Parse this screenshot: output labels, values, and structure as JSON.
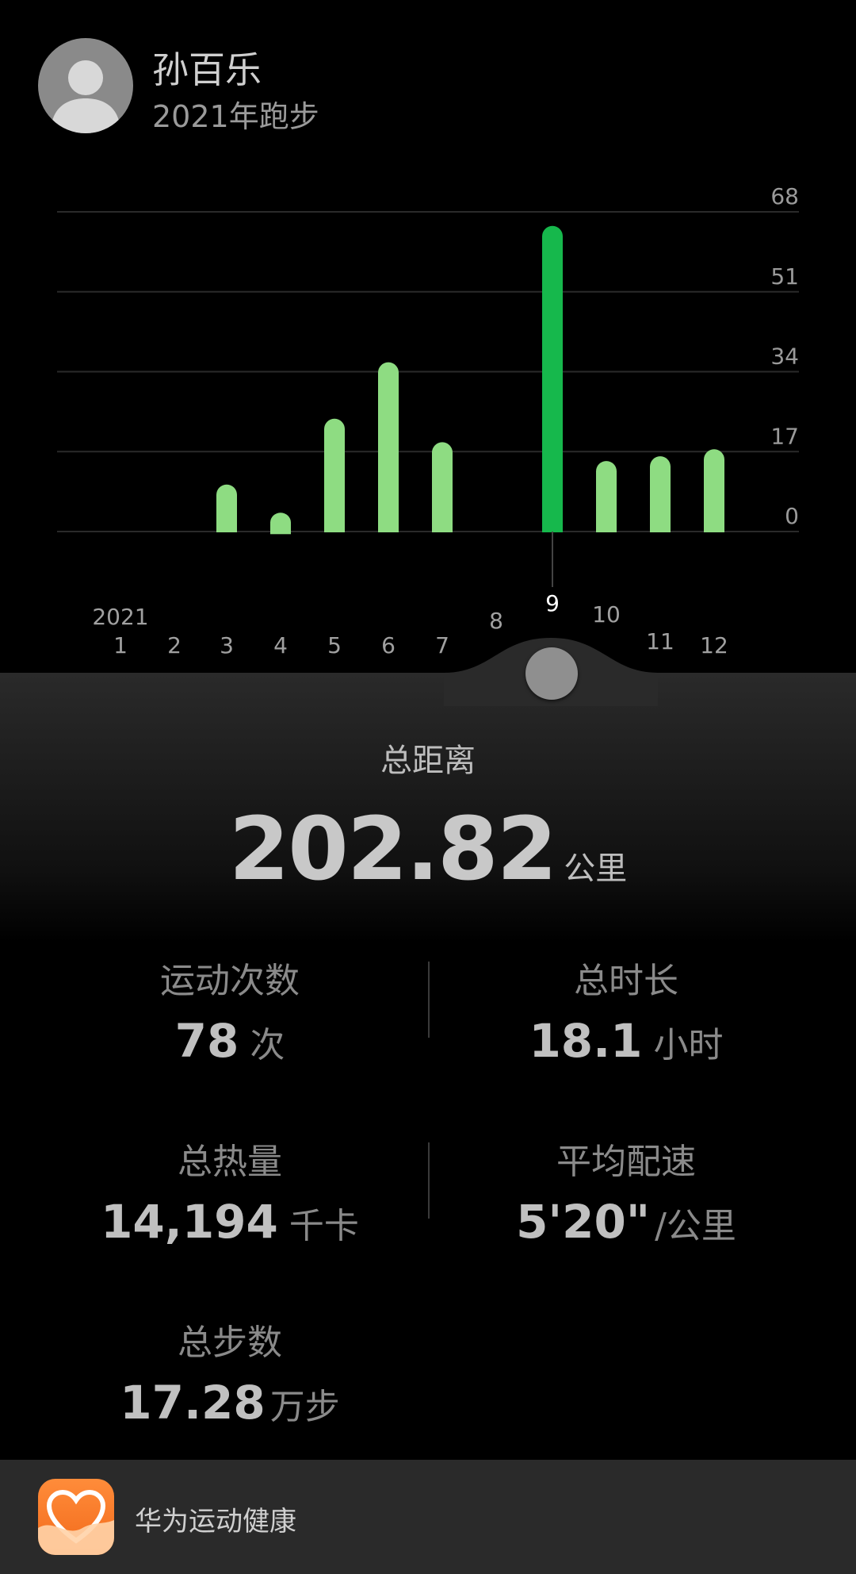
{
  "header": {
    "user_name": "孙百乐",
    "subtitle": "2021年跑步",
    "avatar_icon": "default-avatar-icon"
  },
  "chart_data": {
    "type": "bar",
    "year_label": "2021",
    "categories": [
      "1",
      "2",
      "3",
      "4",
      "5",
      "6",
      "7",
      "8",
      "9",
      "10",
      "11",
      "12"
    ],
    "values": [
      0,
      0,
      10,
      4,
      24,
      36,
      19,
      0,
      65,
      15,
      16,
      17.5
    ],
    "selected_index": 8,
    "y_ticks": [
      "0",
      "17",
      "34",
      "51",
      "68"
    ],
    "ylim": [
      0,
      68
    ],
    "colors": {
      "bar": "#8edc82",
      "selected_bar": "#16b84c",
      "grid": "#2a2a2a"
    }
  },
  "summary": {
    "distance_label": "总距离",
    "distance_value": "202.82",
    "distance_unit": "公里"
  },
  "stats": {
    "sessions": {
      "label": "运动次数",
      "value": "78",
      "unit": "次"
    },
    "duration": {
      "label": "总时长",
      "value": "18.1",
      "unit": "小时"
    },
    "calories": {
      "label": "总热量",
      "value": "14,194",
      "unit": "千卡"
    },
    "pace": {
      "label": "平均配速",
      "value": "5'20\"",
      "unit": "/公里"
    },
    "steps": {
      "label": "总步数",
      "value": "17.28",
      "unit": "万步"
    }
  },
  "app": {
    "name": "华为运动健康",
    "icon": "health-heart-icon"
  }
}
